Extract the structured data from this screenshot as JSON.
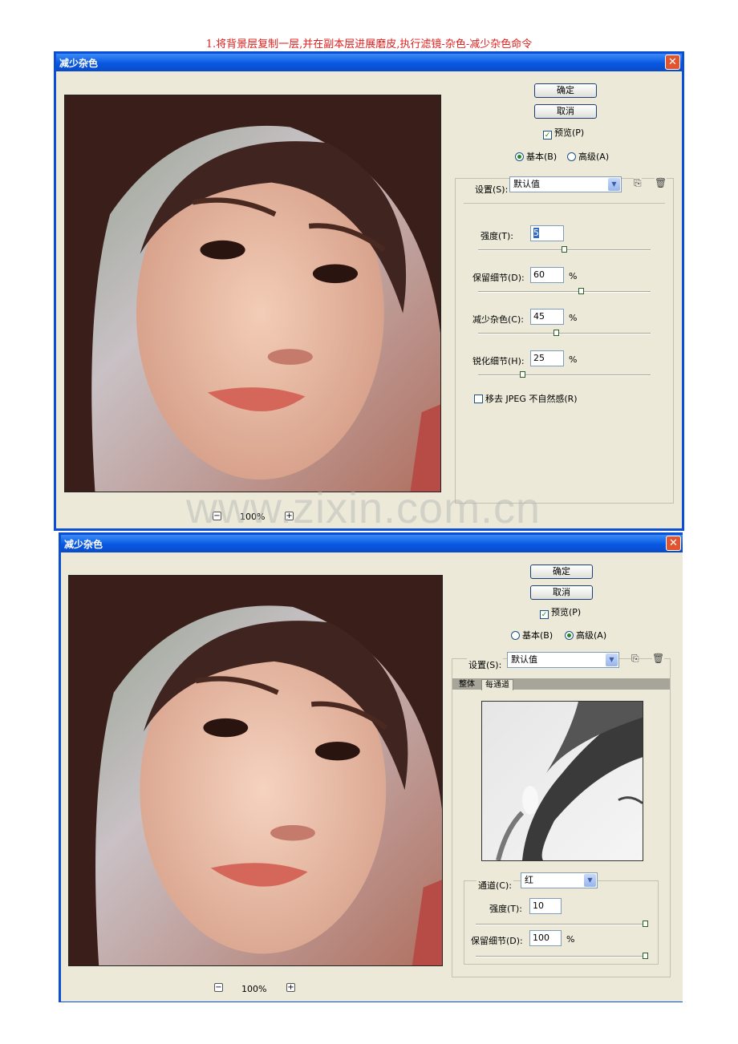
{
  "caption": "1.将背景层复制一层,并在副本层进展磨皮,执行滤镜-杂色-减少杂色命令",
  "watermark": "www.zixin.com.cn",
  "dialog1": {
    "title": "减少杂色",
    "ok": "确定",
    "cancel": "取消",
    "preview": "预览(P)",
    "mode_basic": "基本(B)",
    "mode_advanced": "高级(A)",
    "settings_label": "设置(S):",
    "settings_value": "默认值",
    "strength_label": "强度(T):",
    "strength_value": "5",
    "preserve_label": "保留细节(D):",
    "preserve_value": "60",
    "reduce_label": "减少杂色(C):",
    "reduce_value": "45",
    "sharpen_label": "锐化细节(H):",
    "sharpen_value": "25",
    "percent": "%",
    "jpeg_label": "移去 JPEG 不自然感(R)",
    "zoom": "100%",
    "zoom_out": "−",
    "zoom_in": "+",
    "close": "✕",
    "slider_levels": {
      "strength": 0.5,
      "preserve": 0.6,
      "reduce": 0.45,
      "sharpen": 0.25
    }
  },
  "dialog2": {
    "title": "减少杂色",
    "ok": "确定",
    "cancel": "取消",
    "preview": "预览(P)",
    "mode_basic": "基本(B)",
    "mode_advanced": "高级(A)",
    "settings_label": "设置(S):",
    "settings_value": "默认值",
    "tab_overall": "整体",
    "tab_per_channel": "每通道",
    "channel_label": "通道(C):",
    "channel_value": "红",
    "strength_label": "强度(T):",
    "strength_value": "10",
    "preserve_label": "保留细节(D):",
    "preserve_value": "100",
    "percent": "%",
    "zoom": "100%",
    "zoom_out": "−",
    "zoom_in": "+",
    "close": "✕",
    "slider_levels": {
      "strength": 1.0,
      "preserve": 1.0
    }
  },
  "icons": {
    "save": "save-icon",
    "delete": "trash-icon",
    "dropdown": "chevron-down-icon"
  },
  "colors": {
    "titlebar": "#0858e3",
    "caption": "#e0201e",
    "dialog_bg": "#ece9d8",
    "close": "#e0552f"
  }
}
